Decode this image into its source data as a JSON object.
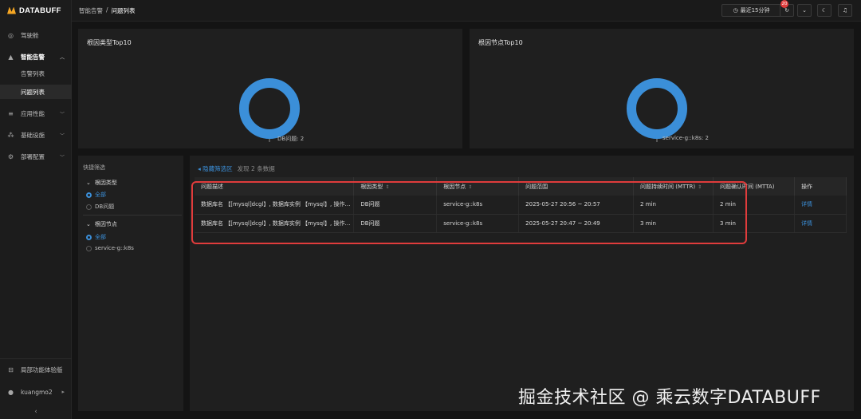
{
  "sidebar": {
    "logo": "DATABUFF",
    "items": [
      {
        "label": "驾驶舱",
        "icon": "dashboard-icon"
      },
      {
        "label": "智能告警",
        "icon": "bell-icon"
      },
      {
        "label": "应用性能",
        "icon": "apm-icon"
      },
      {
        "label": "基础设施",
        "icon": "infrastructure-icon"
      },
      {
        "label": "部署配置",
        "icon": "gear-icon"
      }
    ],
    "sub_items": [
      "告警列表",
      "问题列表"
    ],
    "trial": {
      "label": "局部功能体验版",
      "icon": "trial-icon"
    },
    "user": {
      "name": "kuangmo2",
      "icon": "user-icon"
    },
    "collapse_icon": "chevron-left-icon"
  },
  "header": {
    "breadcrumb": [
      "智能告警",
      "问题列表"
    ],
    "breadcrumb_sep": "/",
    "time_range": "最近15分钟",
    "notification_count": "20"
  },
  "colors": {
    "accent": "#3b8fd9",
    "donut": "#3b8fd9",
    "highlight": "#e03c3c"
  },
  "panels": {
    "root_type": {
      "title": "根因类型Top10",
      "label": "DB问题: 2"
    },
    "root_node": {
      "title": "根因节点Top10",
      "label": "service-g::k8s: 2"
    }
  },
  "chart_data": [
    {
      "type": "pie",
      "title": "根因类型Top10",
      "categories": [
        "DB问题"
      ],
      "values": [
        2
      ]
    },
    {
      "type": "pie",
      "title": "根因节点Top10",
      "categories": [
        "service-g::k8s"
      ],
      "values": [
        2
      ]
    }
  ],
  "filters": {
    "title": "快捷筛选",
    "groups": [
      {
        "label": "根因类型",
        "options": [
          "全部",
          "DB问题"
        ],
        "selected": "全部"
      },
      {
        "label": "根因节点",
        "options": [
          "全部",
          "service-g::k8s"
        ],
        "selected": "全部"
      }
    ]
  },
  "table": {
    "hide_filter": "隐藏筛选区",
    "found": "发现 2 条数据",
    "columns": [
      "问题描述",
      "根因类型",
      "根因节点",
      "问题范围",
      "问题持续时间 (MTTR)",
      "问题确认时间 (MTTA)",
      "操作"
    ],
    "rows": [
      [
        "数据库名 【[mysql]dcgl】, 数据库实例 【mysql】, 操作类型 ...",
        "DB问题",
        "service-g::k8s",
        "2025-05-27 20:56 ~ 20:57",
        "2 min",
        "2 min",
        "详情"
      ],
      [
        "数据库名 【[mysql]dcgl】, 数据库实例 【mysql】, 操作类型 ...",
        "DB问题",
        "service-g::k8s",
        "2025-05-27 20:47 ~ 20:49",
        "3 min",
        "3 min",
        "详情"
      ]
    ]
  },
  "watermark": "掘金技术社区 @ 乘云数字DATABUFF"
}
